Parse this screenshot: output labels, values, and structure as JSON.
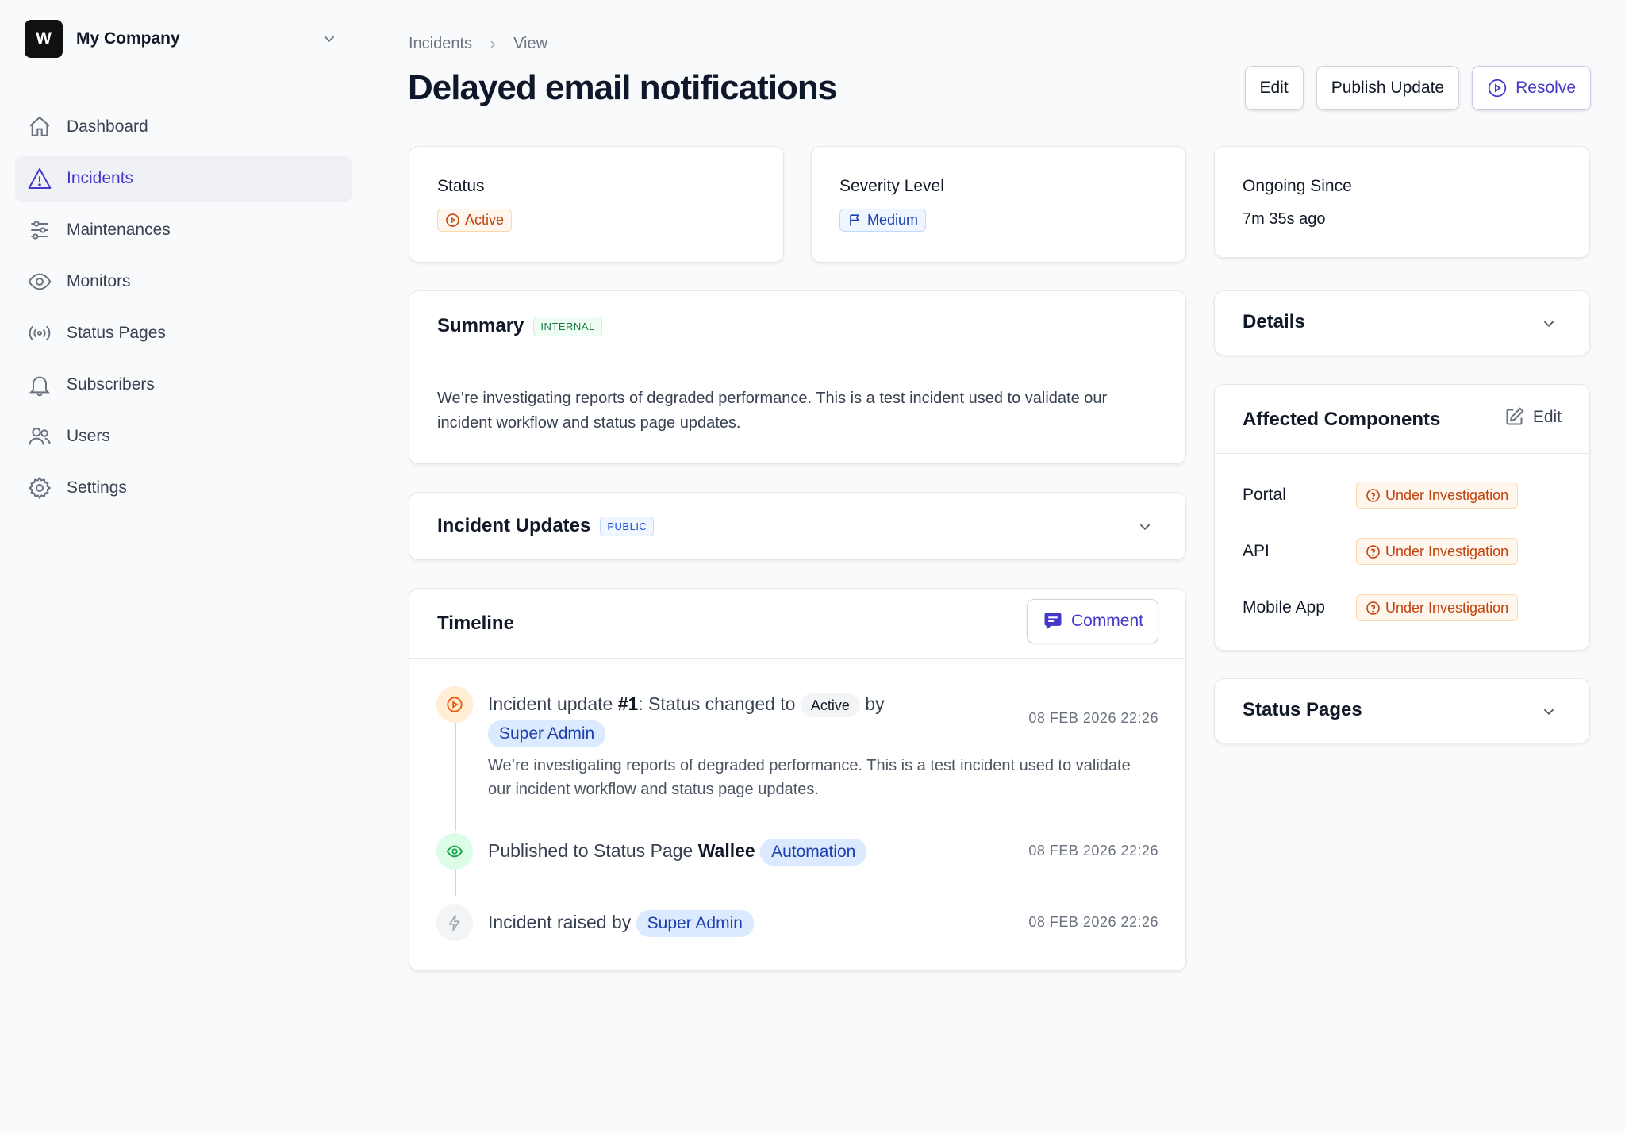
{
  "company": {
    "initial": "W",
    "name": "My Company"
  },
  "nav": [
    {
      "label": "Dashboard",
      "icon": "home-icon"
    },
    {
      "label": "Incidents",
      "icon": "warning-icon",
      "active": true
    },
    {
      "label": "Maintenances",
      "icon": "sliders-icon"
    },
    {
      "label": "Monitors",
      "icon": "eye-icon"
    },
    {
      "label": "Status Pages",
      "icon": "broadcast-icon"
    },
    {
      "label": "Subscribers",
      "icon": "bell-icon"
    },
    {
      "label": "Users",
      "icon": "users-icon"
    },
    {
      "label": "Settings",
      "icon": "gear-icon"
    }
  ],
  "breadcrumb": {
    "parent": "Incidents",
    "current": "View"
  },
  "title": "Delayed email notifications",
  "actions": {
    "edit": "Edit",
    "publish": "Publish Update",
    "resolve": "Resolve"
  },
  "status_card": {
    "label": "Status",
    "value": "Active"
  },
  "severity_card": {
    "label": "Severity Level",
    "value": "Medium"
  },
  "ongoing_card": {
    "label": "Ongoing Since",
    "value": "7m 35s ago"
  },
  "summary": {
    "title": "Summary",
    "tag": "INTERNAL",
    "text": "We’re investigating reports of degraded performance. This is a test incident used to validate our incident workflow and status page updates."
  },
  "incident_updates": {
    "title": "Incident Updates",
    "tag": "PUBLIC"
  },
  "timeline": {
    "title": "Timeline",
    "comment_label": "Comment",
    "entries": [
      {
        "prefix": "Incident update ",
        "number": "#1",
        "middle": ": Status changed to ",
        "status": "Active",
        "by": " by",
        "user": "Super Admin",
        "description": "We’re investigating reports of degraded performance. This is a test incident used to validate our incident workflow and status page updates.",
        "date": "08 FEB 2026 22:26"
      },
      {
        "prefix": "Published to Status Page ",
        "page": "Wallee",
        "chip": "Automation",
        "date": "08 FEB 2026 22:26"
      },
      {
        "prefix": "Incident raised by ",
        "user": "Super Admin",
        "date": "08 FEB 2026 22:26"
      }
    ]
  },
  "details": {
    "title": "Details"
  },
  "affected": {
    "title": "Affected Components",
    "edit_label": "Edit",
    "components": [
      {
        "name": "Portal",
        "status": "Under Investigation"
      },
      {
        "name": "API",
        "status": "Under Investigation"
      },
      {
        "name": "Mobile App",
        "status": "Under Investigation"
      }
    ]
  },
  "status_pages": {
    "title": "Status Pages"
  },
  "colors": {
    "accent": "#4338ca",
    "active": "#c2410c",
    "medium": "#1e40af",
    "success": "#15803d"
  }
}
